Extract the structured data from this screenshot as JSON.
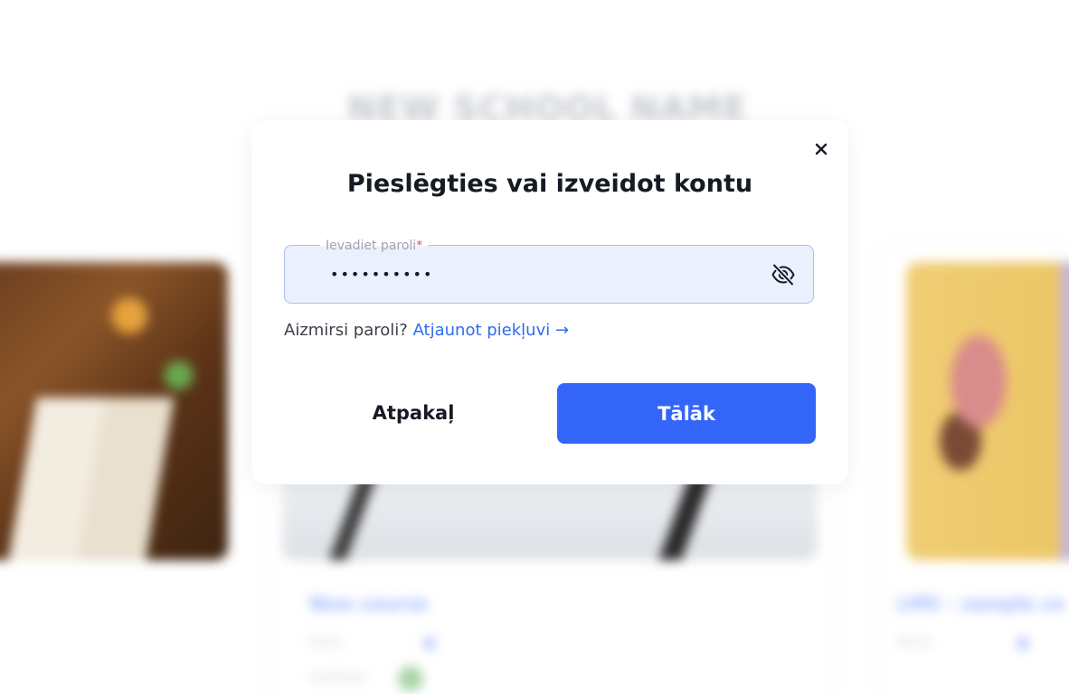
{
  "background": {
    "school_title": "NEW SCHOOL NAME",
    "cards": [
      {
        "title": "New course",
        "meta": "Kurss",
        "author": "Izveidots"
      },
      {
        "title": "LMS – sample co",
        "meta": "Kurss"
      }
    ]
  },
  "modal": {
    "title": "Pieslēgties vai izveidot kontu",
    "close_icon": "close-icon",
    "password_field": {
      "label": "Ievadiet paroli",
      "required_mark": "*",
      "value": "••••••••••",
      "toggle_icon": "eye-off-icon"
    },
    "forgot": {
      "text": "Aizmirsi paroli?",
      "link": "Atjaunot piekļuvi →"
    },
    "buttons": {
      "back": "Atpakaļ",
      "next": "Tālāk"
    }
  },
  "colors": {
    "primary": "#3366f8",
    "link": "#2f6bef",
    "field_bg": "#eaf0fd",
    "field_border": "#aebfef",
    "required": "#e5484d"
  }
}
